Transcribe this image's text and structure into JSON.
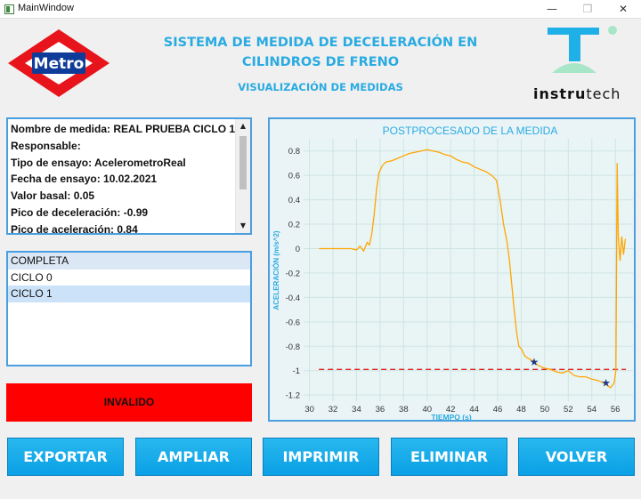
{
  "window": {
    "title": "MainWindow",
    "minimize_glyph": "—",
    "maximize_glyph": "❐",
    "close_glyph": "✕"
  },
  "logo": {
    "metro_text": "Metro",
    "instru_bold": "instru",
    "instru_rest": "tech"
  },
  "header": {
    "title_line1": "SISTEMA DE MEDIDA DE DECELERACIÓN EN",
    "title_line2": "CILINDROS DE FRENO",
    "subtitle": "VISUALIZACIÓN DE MEDIDAS"
  },
  "info": {
    "lines": [
      "Nombre de medida: REAL PRUEBA CICLO 1",
      "Responsable:",
      "Tipo de ensayo: AcelerometroReal",
      "Fecha de ensayo: 10.02.2021",
      "Valor basal: 0.05",
      "Pico de deceleración: -0.99",
      "Pico de aceleración: 0.84"
    ]
  },
  "cycles": {
    "items": [
      "COMPLETA",
      "CICLO 0",
      "CICLO 1"
    ],
    "selected": "CICLO 1"
  },
  "status": {
    "label": "INVALIDO",
    "color": "#ff0000"
  },
  "buttons": {
    "export": "EXPORTAR",
    "zoom": "AMPLIAR",
    "print": "IMPRIMIR",
    "delete": "ELIMINAR",
    "back": "VOLVER"
  },
  "colors": {
    "accent": "#29abe2",
    "button": "#0aa0e6",
    "series": "#ffa500",
    "threshold": "#e02020",
    "marker": "#1f3a8a"
  },
  "chart_data": {
    "type": "line",
    "title": "POSTPROCESADO DE LA MEDIDA",
    "xlabel": "TIEMPO (s)",
    "ylabel": "ACELERACIÓN (m/s^2)",
    "xlim": [
      29.5,
      57.5
    ],
    "ylim": [
      -1.25,
      0.9
    ],
    "xticks": [
      "30",
      "32",
      "34",
      "36",
      "38",
      "40",
      "42",
      "44",
      "46",
      "48",
      "50",
      "52",
      "54",
      "56"
    ],
    "yticks": [
      "0.8",
      "0.6",
      "0.4",
      "0.2",
      "0",
      "-0.2",
      "-0.4",
      "-0.6",
      "-0.8",
      "-1",
      "-1.2"
    ],
    "grid": true,
    "series": [
      {
        "x": [
          30.8,
          31.5,
          32.5,
          33.5,
          34.0,
          34.3,
          34.6,
          34.9,
          35.1,
          35.3,
          35.5,
          35.7,
          35.9,
          36.2,
          36.5,
          37.0,
          37.5,
          38.0,
          38.5,
          39.0,
          39.5,
          40.0,
          40.5,
          41.0,
          41.5,
          42.0,
          42.5,
          43.0,
          43.5,
          44.0,
          44.5,
          45.0,
          45.5,
          45.9,
          46.2,
          46.5,
          46.8,
          47.0,
          47.2,
          47.4,
          47.6,
          47.8,
          48.0,
          48.3,
          48.6,
          49.0,
          49.5,
          50.0,
          50.5,
          51.0,
          51.5,
          52.0,
          52.5,
          53.0,
          53.5,
          54.0,
          54.5,
          55.0,
          55.3,
          55.6,
          55.9,
          56.05,
          56.15,
          56.25,
          56.4,
          56.55,
          56.7,
          56.85
        ],
        "y": [
          0.0,
          0.0,
          0.0,
          0.0,
          -0.01,
          0.02,
          -0.02,
          0.05,
          0.03,
          0.12,
          0.28,
          0.48,
          0.62,
          0.68,
          0.71,
          0.72,
          0.74,
          0.76,
          0.78,
          0.79,
          0.8,
          0.81,
          0.8,
          0.79,
          0.77,
          0.76,
          0.73,
          0.71,
          0.7,
          0.67,
          0.65,
          0.63,
          0.6,
          0.56,
          0.4,
          0.2,
          0.05,
          -0.1,
          -0.3,
          -0.5,
          -0.68,
          -0.8,
          -0.82,
          -0.88,
          -0.9,
          -0.92,
          -0.96,
          -0.98,
          -0.99,
          -1.01,
          -1.02,
          -1.0,
          -1.04,
          -1.05,
          -1.05,
          -1.07,
          -1.08,
          -1.1,
          -1.12,
          -1.14,
          -1.1,
          -1.0,
          0.7,
          0.1,
          -0.1,
          0.1,
          -0.05,
          0.08
        ]
      }
    ],
    "threshold": -0.99,
    "markers": [
      {
        "x": 49.1,
        "y": -0.93
      },
      {
        "x": 55.2,
        "y": -1.1
      }
    ]
  }
}
